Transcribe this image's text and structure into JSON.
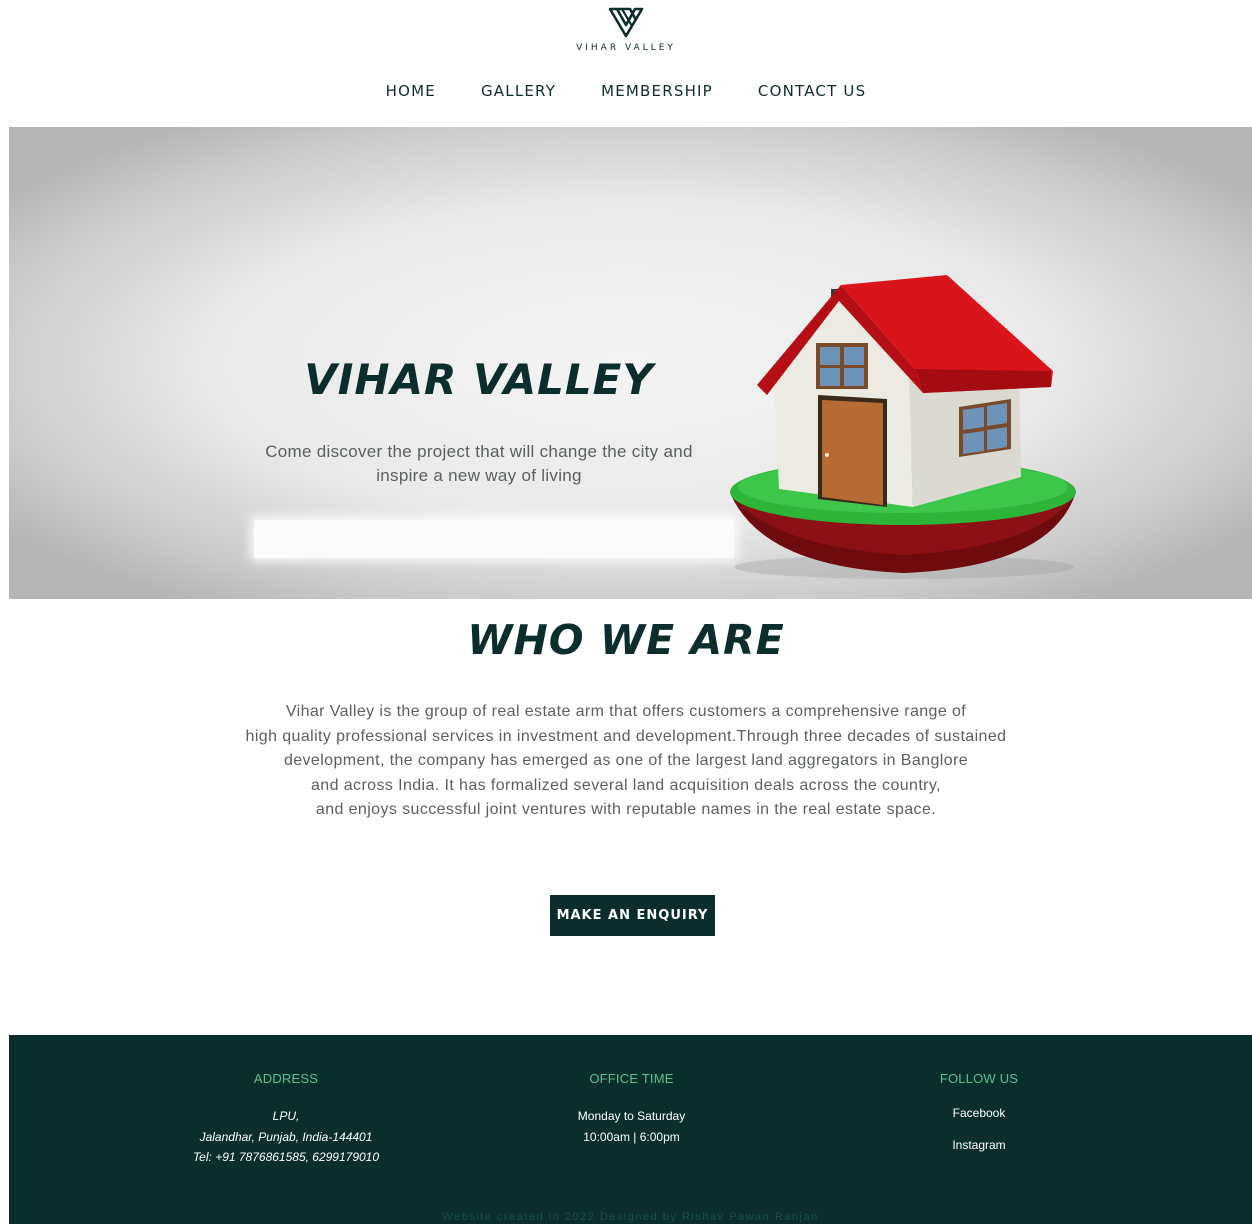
{
  "brand": {
    "name": "VIHAR VALLEY",
    "logo_icon": "v-monogram-icon"
  },
  "nav": {
    "items": [
      "HOME",
      "GALLERY",
      "MEMBERSHIP",
      "CONTACT US"
    ]
  },
  "hero": {
    "title": "VIHAR VALLEY",
    "subtitle_line1": "Come discover the project that will change the city and",
    "subtitle_line2": "inspire a new way of living",
    "image_icon": "house-icon"
  },
  "about": {
    "title": "WHO WE ARE",
    "lines": [
      "Vihar Valley is the group of real estate arm that offers customers a comprehensive range of",
      "high quality professional services in investment and development.Through three decades of sustained",
      "development, the company has emerged as one of the largest land aggregators in Banglore",
      "and across India. It has formalized several land acquisition deals across the country,",
      "and enjoys successful joint ventures with reputable names in the real estate space."
    ],
    "cta_label": "MAKE AN ENQUIRY"
  },
  "footer": {
    "address": {
      "heading": "ADDRESS",
      "line1": "LPU,",
      "line2": "Jalandhar, Punjab, India-144401",
      "line3": "Tel: +91 7876861585, 6299179010"
    },
    "office": {
      "heading": "OFFICE TIME",
      "line1": "Monday to Saturday",
      "line2": "10:00am | 6:00pm"
    },
    "follow": {
      "heading": "FOLLOW US",
      "links": [
        "Facebook",
        "Instagram"
      ]
    },
    "credit": "Website created in 2022 Designed by Rishav Pawan Ranjan"
  },
  "colors": {
    "primary": "#0a2e2c",
    "accent": "#5fc08f",
    "roof": "#d9141b",
    "grass": "#2db53a"
  }
}
